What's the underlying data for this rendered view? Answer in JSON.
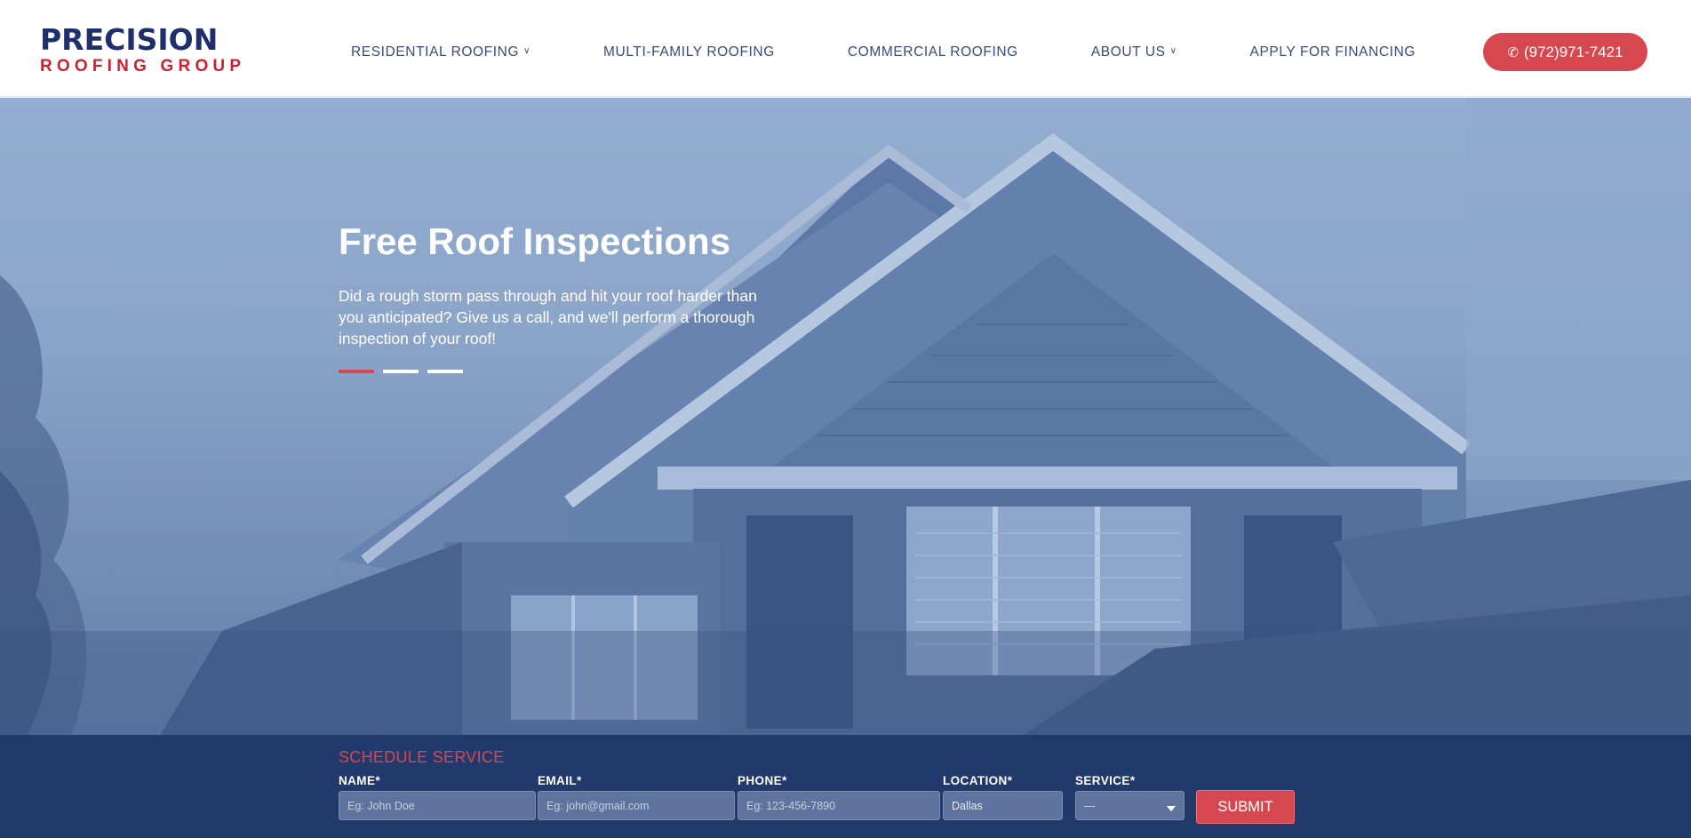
{
  "header": {
    "logo": {
      "line1": "PRECISION",
      "line2": "ROOFING GROUP"
    },
    "nav": [
      {
        "label": "RESIDENTIAL ROOFING",
        "dropdown": true
      },
      {
        "label": "MULTI-FAMILY ROOFING",
        "dropdown": false
      },
      {
        "label": "COMMERCIAL ROOFING",
        "dropdown": false
      },
      {
        "label": "ABOUT US",
        "dropdown": true
      },
      {
        "label": "APPLY FOR FINANCING",
        "dropdown": false
      }
    ],
    "phone": {
      "label": "(972)971-7421",
      "icon": "phone-icon"
    }
  },
  "hero": {
    "title": "Free Roof Inspections",
    "text": "Did a rough storm pass through and hit your roof harder than you anticipated? Give us a call, and we'll perform a thorough inspection of your roof!",
    "slides": 3,
    "active_slide": 1
  },
  "schedule": {
    "title": "SCHEDULE SERVICE",
    "fields": [
      {
        "label": "NAME*",
        "placeholder": "Eg: John Doe"
      },
      {
        "label": "EMAIL*",
        "placeholder": "Eg: john@gmail.com"
      },
      {
        "label": "PHONE*",
        "placeholder": "Eg: 123-456-7890"
      },
      {
        "label": "LOCATION*",
        "value": "Dallas"
      },
      {
        "label": "SERVICE*",
        "value": "---"
      }
    ],
    "submit_label": "SUBMIT"
  },
  "colors": {
    "brand_navy": "#1f2f6e",
    "brand_red": "#d6474f",
    "form_bar": "#213a6b"
  }
}
